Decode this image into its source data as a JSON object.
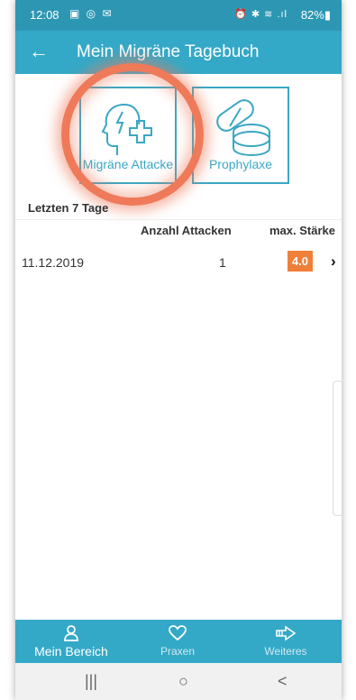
{
  "status_bar": {
    "time": "12:08",
    "left_icons": "▣ ◎ ✉",
    "right_icons": "⏰ ✱ ≋ .ıl",
    "battery": "82%▮"
  },
  "app_bar": {
    "back_icon": "←",
    "title": "Mein Migräne Tagebuch"
  },
  "tiles": [
    {
      "label": "Migräne Attacke",
      "icon": "head-plus-icon"
    },
    {
      "label": "Prophylaxe",
      "icon": "pills-icon"
    }
  ],
  "summary": {
    "section_title": "Letzten 7 Tage",
    "col_attacks": "Anzahl Attacken",
    "col_max": "max. Stärke",
    "rows": [
      {
        "date": "11.12.2019",
        "count": "1",
        "max": "4.0",
        "chevron": "›"
      }
    ]
  },
  "bottom_nav": {
    "items": [
      {
        "label": "Mein Bereich",
        "icon": "person-icon"
      },
      {
        "label": "Praxen",
        "icon": "heart-icon"
      },
      {
        "label": "Weiteres",
        "icon": "arrow-right-icon"
      }
    ]
  },
  "system_nav": {
    "recent": "|||",
    "home": "○",
    "back": "<"
  },
  "colors": {
    "primary": "#34a9c7",
    "status_bar": "#2d97b3",
    "highlight": "#ee7a5a",
    "badge": "#f07f3a"
  }
}
